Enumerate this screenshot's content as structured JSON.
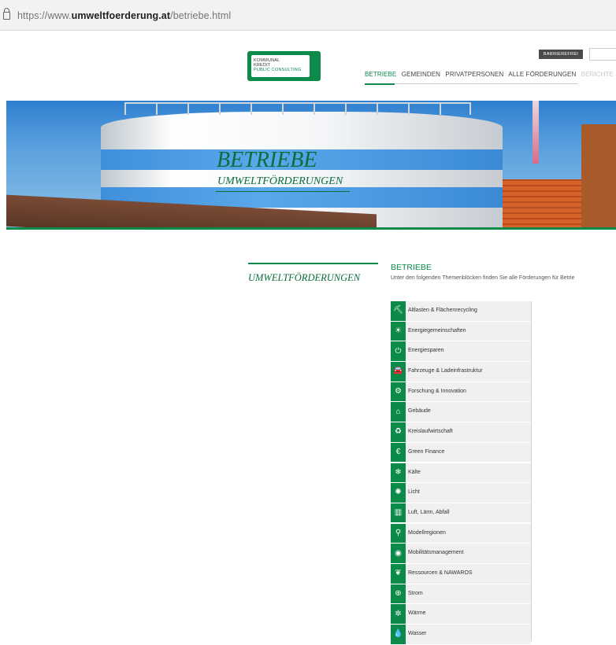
{
  "browser": {
    "url_prefix": "https://www.",
    "url_host": "umweltfoerderung.at",
    "url_path": "/betriebe.html"
  },
  "header": {
    "logo_lines": [
      "KOMMUNAL",
      "KREDIT",
      "PUBLIC CONSULTING"
    ],
    "barrierefrei_label": "BARRIEREFREI",
    "nav": [
      "BETRIEBE",
      "GEMEINDEN",
      "PRIVATPERSONEN",
      "ALLE FÖRDERUNGEN",
      "BERICHTE &"
    ],
    "active_nav": "BETRIEBE"
  },
  "hero": {
    "title": "BETRIEBE",
    "subtitle": "UMWELTFÖRDERUNGEN"
  },
  "sidebar": {
    "title": "UMWELTFÖRDERUNGEN"
  },
  "main": {
    "title": "BETRIEBE",
    "intro": "Unter den folgenden Themenblöcken finden Sie alle Förderungen für Betrie",
    "topics": [
      {
        "label": "Altlasten & Flächenrecycling",
        "icon": "excavator-icon",
        "glyph": "⛏"
      },
      {
        "label": "Energiegemeinschaften",
        "icon": "sun-icon",
        "glyph": "☀"
      },
      {
        "label": "Energiesparen",
        "icon": "power-icon",
        "glyph": "⏻"
      },
      {
        "label": "Fahrzeuge & Ladeinfrastruktur",
        "icon": "car-icon",
        "glyph": "🚘"
      },
      {
        "label": "Forschung & Innovation",
        "icon": "gear-icon",
        "glyph": "⚙"
      },
      {
        "label": "Gebäude",
        "icon": "house-icon",
        "glyph": "⌂"
      },
      {
        "label": "Kreislaufwirtschaft",
        "icon": "recycle-icon",
        "glyph": "♻"
      },
      {
        "label": "Green Finance",
        "icon": "euro-icon",
        "glyph": "€"
      },
      {
        "label": "Kälte",
        "icon": "snowflake-drop-icon",
        "glyph": "❄"
      },
      {
        "label": "Licht",
        "icon": "lightbulb-icon",
        "glyph": "✺"
      },
      {
        "label": "Luft, Lärm, Abfall",
        "icon": "bin-icon",
        "glyph": "▥"
      },
      {
        "label": "Modellregionen",
        "icon": "region-pin-icon",
        "glyph": "⚲"
      },
      {
        "label": "Mobilitätsmanagement",
        "icon": "mobility-icon",
        "glyph": "◉"
      },
      {
        "label": "Ressourcen & NAWAROS",
        "icon": "leaf-icon",
        "glyph": "❦"
      },
      {
        "label": "Strom",
        "icon": "plug-icon",
        "glyph": "⊕"
      },
      {
        "label": "Wärme",
        "icon": "heat-icon",
        "glyph": "✲"
      },
      {
        "label": "Wasser",
        "icon": "water-drop-icon",
        "glyph": "💧"
      }
    ]
  },
  "colors": {
    "brand_green": "#0b8a4a",
    "dark_green": "#0b6e3c",
    "list_bg": "#f0f0f0"
  }
}
